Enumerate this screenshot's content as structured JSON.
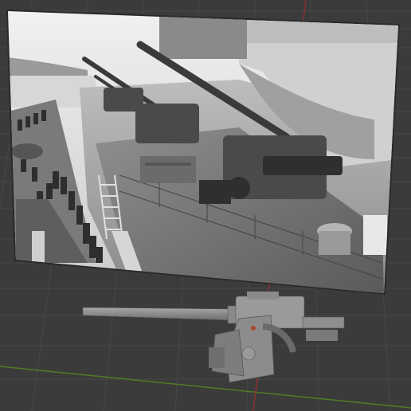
{
  "viewport": {
    "label": "3D viewport",
    "background": "#3b3b3b",
    "grid_color": "#4a4a4a",
    "x_axis_color": "#8a3a3a",
    "y_axis_color": "#5a8a2a"
  },
  "reference_image": {
    "description_icon": "photo-reference-icon",
    "tone": "grayscale"
  },
  "model": {
    "icon": "anti-aircraft-gun-model-icon",
    "color": "#8c8c8c",
    "accent": "#a84a2a"
  }
}
